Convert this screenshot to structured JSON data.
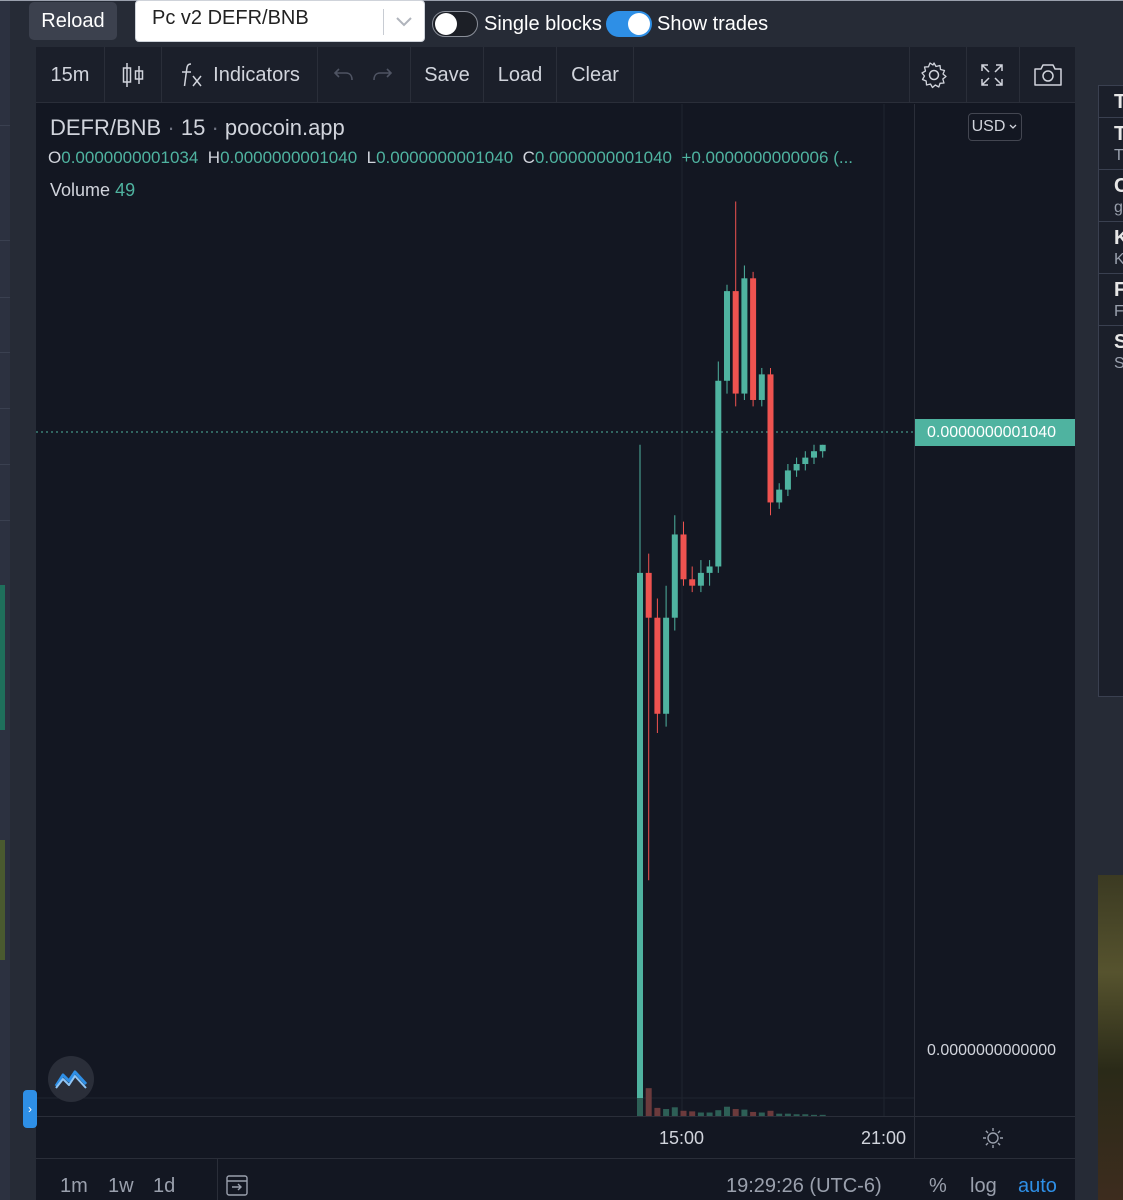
{
  "top": {
    "reload_label": "Reload",
    "pair_value": "Pc v2 DEFR/BNB",
    "single_blocks_label": "Single blocks",
    "single_blocks_on": false,
    "show_trades_label": "Show trades",
    "show_trades_on": true
  },
  "toolbar": {
    "interval": "15m",
    "indicators_label": "Indicators",
    "save_label": "Save",
    "load_label": "Load",
    "clear_label": "Clear"
  },
  "legend": {
    "symbol": "DEFR/BNB",
    "interval": "15",
    "source": "poocoin.app",
    "o_key": "O",
    "o_val": "0.0000000001034",
    "h_key": "H",
    "h_val": "0.0000000001040",
    "l_key": "L",
    "l_val": "0.0000000001040",
    "c_key": "C",
    "c_val": "0.0000000001040",
    "change": "+0.0000000000006 (...",
    "volume_label": "Volume",
    "volume_val": "49",
    "currency": "USD"
  },
  "price_axis": {
    "last_price": "0.0000000001040",
    "zero_price": "0.0000000000000"
  },
  "time_axis": {
    "labels": [
      "15:00",
      "21:00"
    ]
  },
  "bottom": {
    "ranges": [
      "1m",
      "1w",
      "1d"
    ],
    "clock": "19:29:26 (UTC-6)",
    "percent": "%",
    "log": "log",
    "auto": "auto"
  },
  "colors": {
    "up": "#4fb3a0",
    "down": "#ef5350",
    "background": "#131722",
    "accent": "#2e8fe6"
  },
  "right_panel": {
    "rows": [
      {
        "big": "T",
        "small": ""
      },
      {
        "big": "T",
        "small": "T"
      },
      {
        "big": "C",
        "small": "g"
      },
      {
        "big": "K",
        "small": "K"
      },
      {
        "big": "F",
        "small": "F"
      },
      {
        "big": "S",
        "small": "S"
      }
    ]
  },
  "chart_data": {
    "type": "candlestick",
    "pair": "DEFR/BNB",
    "price_unit": "1e-10 BNB",
    "ylim": [
      0,
      2.0
    ],
    "candles": [
      {
        "o": 0.0,
        "h": 1.02,
        "l": 0.0,
        "c": 0.82
      },
      {
        "o": 0.82,
        "h": 0.85,
        "l": 0.34,
        "c": 0.75
      },
      {
        "o": 0.75,
        "h": 0.78,
        "l": 0.57,
        "c": 0.6
      },
      {
        "o": 0.6,
        "h": 0.8,
        "l": 0.58,
        "c": 0.75
      },
      {
        "o": 0.75,
        "h": 0.91,
        "l": 0.73,
        "c": 0.88
      },
      {
        "o": 0.88,
        "h": 0.9,
        "l": 0.8,
        "c": 0.81
      },
      {
        "o": 0.81,
        "h": 0.83,
        "l": 0.79,
        "c": 0.8
      },
      {
        "o": 0.8,
        "h": 0.84,
        "l": 0.79,
        "c": 0.82
      },
      {
        "o": 0.82,
        "h": 0.84,
        "l": 0.8,
        "c": 0.83
      },
      {
        "o": 0.83,
        "h": 1.15,
        "l": 0.82,
        "c": 1.12
      },
      {
        "o": 1.12,
        "h": 1.27,
        "l": 1.1,
        "c": 1.26
      },
      {
        "o": 1.26,
        "h": 1.4,
        "l": 1.08,
        "c": 1.1
      },
      {
        "o": 1.1,
        "h": 1.3,
        "l": 1.09,
        "c": 1.28
      },
      {
        "o": 1.28,
        "h": 1.29,
        "l": 1.08,
        "c": 1.09
      },
      {
        "o": 1.09,
        "h": 1.14,
        "l": 1.08,
        "c": 1.13
      },
      {
        "o": 1.13,
        "h": 1.14,
        "l": 0.91,
        "c": 0.93
      },
      {
        "o": 0.93,
        "h": 0.96,
        "l": 0.92,
        "c": 0.95
      },
      {
        "o": 0.95,
        "h": 0.99,
        "l": 0.94,
        "c": 0.98
      },
      {
        "o": 0.98,
        "h": 1.0,
        "l": 0.97,
        "c": 0.99
      },
      {
        "o": 0.99,
        "h": 1.01,
        "l": 0.98,
        "c": 1.0
      },
      {
        "o": 1.0,
        "h": 1.02,
        "l": 0.99,
        "c": 1.01
      },
      {
        "o": 1.01,
        "h": 1.02,
        "l": 1.0,
        "c": 1.02
      }
    ],
    "volumes": [
      100,
      48,
      14,
      12,
      15,
      9,
      8,
      6,
      6,
      10,
      16,
      12,
      11,
      7,
      6,
      9,
      4,
      4,
      3,
      3,
      2,
      2
    ]
  }
}
